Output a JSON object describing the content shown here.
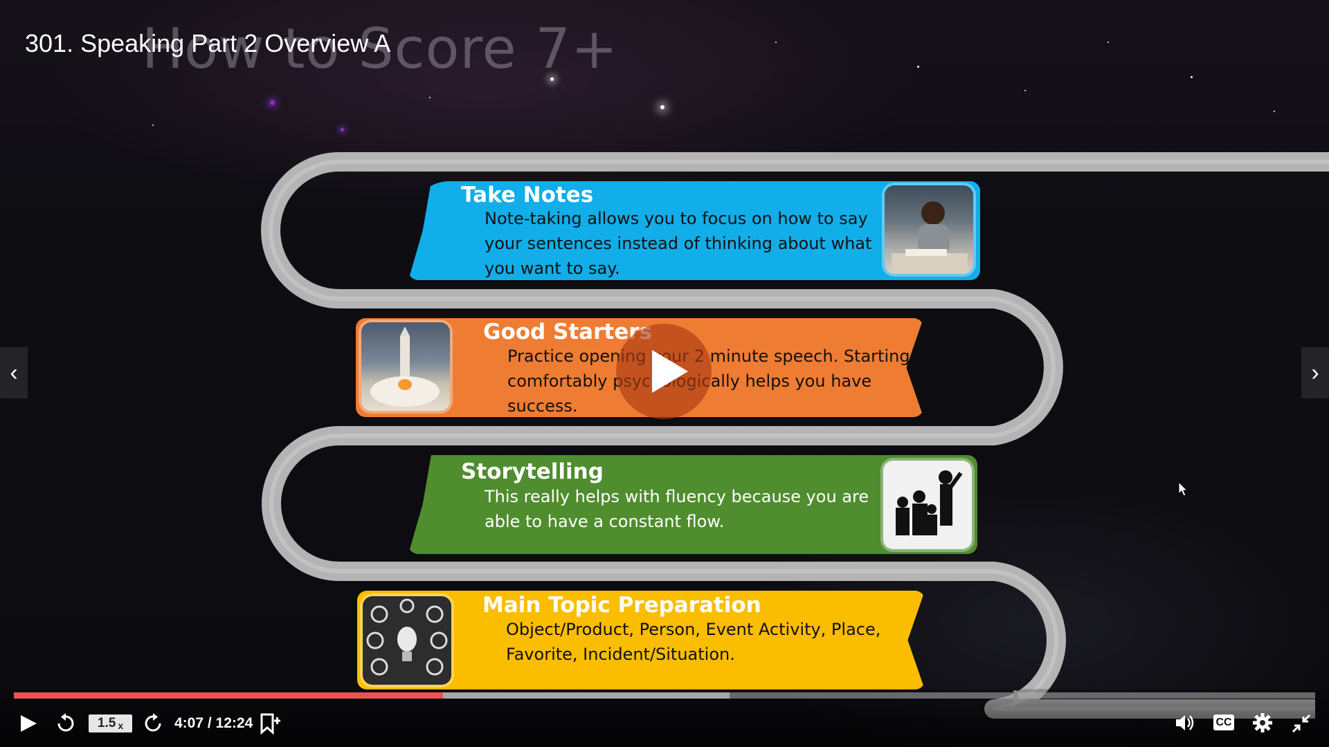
{
  "video": {
    "title": "301. Speaking Part 2 Overview A",
    "slide_heading": "How to Score 7+"
  },
  "slide": {
    "items": [
      {
        "title": "Take Notes",
        "lines": [
          "Note-taking allows you to focus on how to say",
          "your sentences instead of thinking  about what",
          "you want to say."
        ],
        "color": "#11aee9",
        "image": "student-writing-photo"
      },
      {
        "title": "Good Starters",
        "lines": [
          "Practice opening your 2 minute speech. Starting",
          "comfortably psychologically helps you have",
          "success."
        ],
        "color": "#ef7c33",
        "image": "rocket-launch-photo"
      },
      {
        "title": "Storytelling",
        "lines": [
          "This really helps with fluency because you are",
          "able to have a constant flow."
        ],
        "color": "#4f8d2e",
        "image": "storyteller-silhouette"
      },
      {
        "title": "Main Topic Preparation",
        "lines": [
          "Object/Product, Person, Event Activity, Place,",
          "Favorite, Incident/Situation."
        ],
        "color": "#fbbd00",
        "image": "lightbulb-mindmap"
      }
    ]
  },
  "player": {
    "speed_label": "1.5",
    "speed_suffix": "x",
    "time_display": "4:07 / 12:24",
    "progress_played_fraction": 0.33,
    "progress_buffered_fraction": 0.55,
    "accent": "#ec5252",
    "icons": [
      "play-icon",
      "rewind-icon",
      "forward-icon",
      "bookmark-add-icon",
      "volume-icon",
      "cc-icon",
      "settings-icon",
      "exit-fullscreen-icon"
    ]
  }
}
